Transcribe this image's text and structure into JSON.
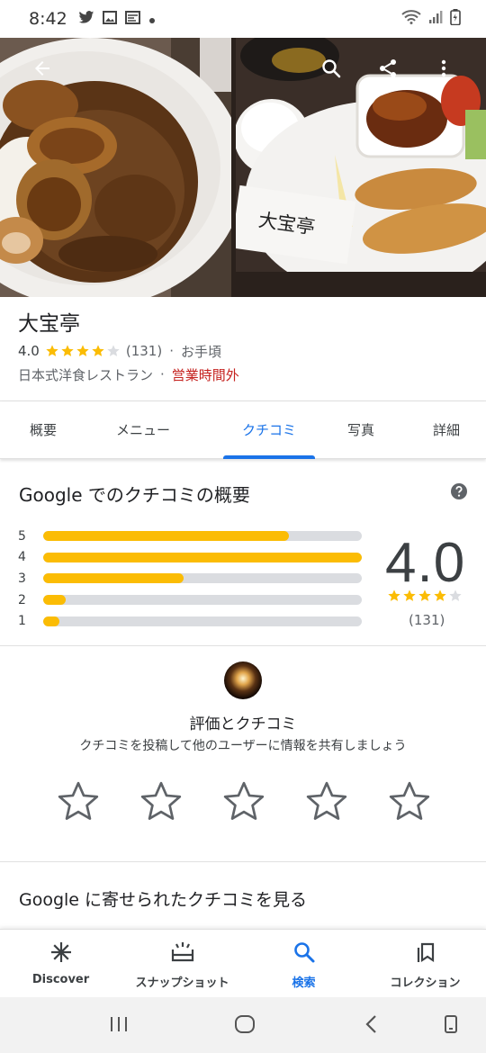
{
  "status_bar": {
    "time": "8:42",
    "left_icons": [
      "twitter-icon",
      "image-icon",
      "cast-icon",
      "dot-icon"
    ],
    "right_icons": [
      "wifi-icon",
      "signal-icon",
      "battery-icon"
    ]
  },
  "hero": {
    "buttons": [
      "back-arrow-icon",
      "search-icon",
      "share-icon",
      "more-vert-icon"
    ],
    "sign_text": "大宝亭"
  },
  "place": {
    "name": "大宝亭",
    "rating": "4.0",
    "rating_value": 4,
    "review_count": "(131)",
    "price": "お手頃",
    "separator": "·",
    "category": "日本式洋食レストラン",
    "status": "営業時間外"
  },
  "tabs": [
    {
      "label": "概要",
      "active": false
    },
    {
      "label": "メニュー",
      "active": false
    },
    {
      "label": "クチコミ",
      "active": true
    },
    {
      "label": "写真",
      "active": false
    },
    {
      "label": "詳細",
      "active": false
    }
  ],
  "summary": {
    "title": "Google でのクチコミの概要",
    "score": "4.0",
    "score_value": 4,
    "count": "(131)",
    "distribution": [
      {
        "label": "5",
        "fraction": 0.77
      },
      {
        "label": "4",
        "fraction": 1.0
      },
      {
        "label": "3",
        "fraction": 0.44
      },
      {
        "label": "2",
        "fraction": 0.07
      },
      {
        "label": "1",
        "fraction": 0.05
      }
    ]
  },
  "rate": {
    "title": "評価とクチコミ",
    "subtitle": "クチコミを投稿して他のユーザーに情報を共有しましょう",
    "star_count": 5
  },
  "reviews_link": "Google に寄せられたクチコミを見る",
  "bottom_nav": [
    {
      "label": "Discover",
      "icon": "asterisk-icon",
      "active": false
    },
    {
      "label": "スナップショット",
      "icon": "snapshot-icon",
      "active": false
    },
    {
      "label": "検索",
      "icon": "search-icon",
      "active": true
    },
    {
      "label": "コレクション",
      "icon": "collections-icon",
      "active": false
    }
  ],
  "colors": {
    "accent": "#1a73e8",
    "star": "#fbbc04",
    "closed": "#c5221f"
  }
}
